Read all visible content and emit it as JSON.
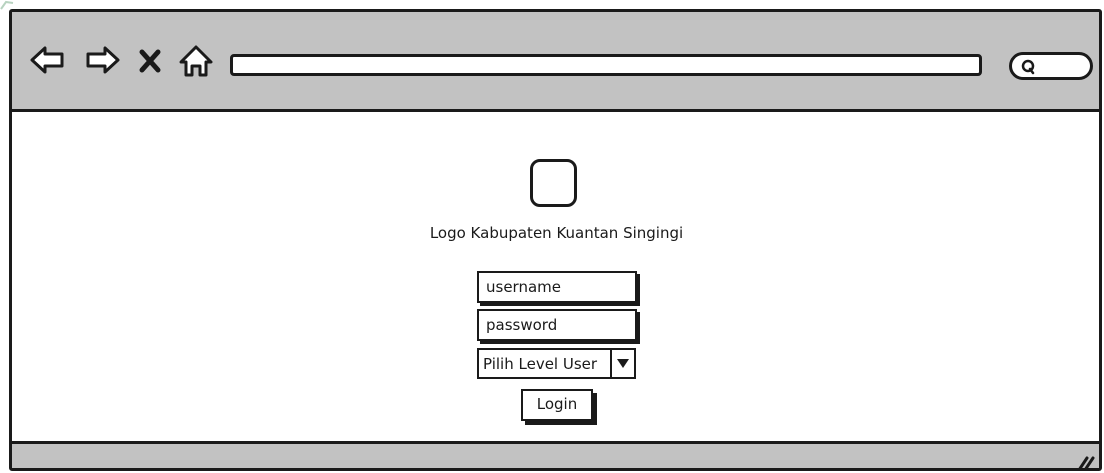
{
  "browser": {
    "nav_icons": [
      "back-arrow-icon",
      "forward-arrow-icon",
      "stop-x-icon",
      "home-icon"
    ],
    "address_value": "",
    "search_icon": "search-icon"
  },
  "login_page": {
    "logo_caption": "Logo Kabupaten Kuantan Singingi",
    "username_placeholder": "username",
    "password_placeholder": "password",
    "level_select_value": "Pilih Level User",
    "login_label": "Login"
  },
  "colors": {
    "chrome_gray": "#c2c2c2",
    "stroke": "#1a1a1a",
    "background": "#ffffff"
  }
}
